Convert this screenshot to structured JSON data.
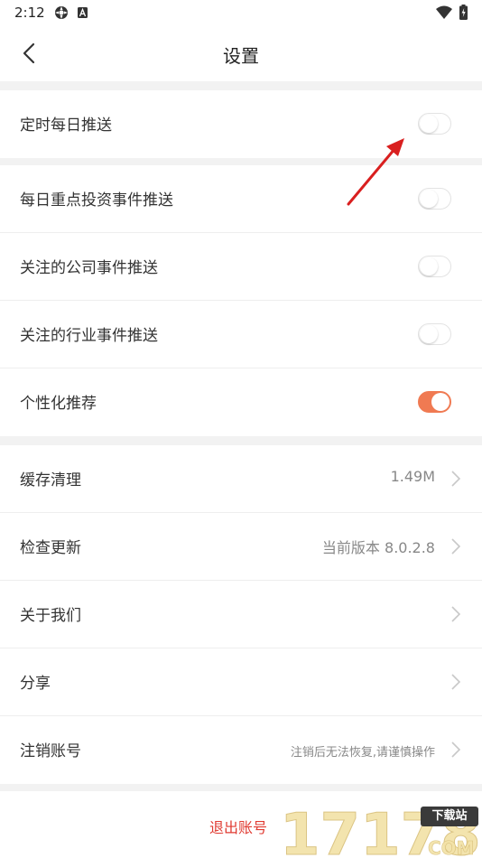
{
  "status_bar": {
    "time": "2:12",
    "icons": [
      "settings-gear-icon",
      "app-a-icon",
      "wifi-icon",
      "battery-icon"
    ]
  },
  "header": {
    "back_icon": "chevron-left-icon",
    "title": "设置"
  },
  "push_group": {
    "items": [
      {
        "label": "定时每日推送",
        "toggle_on": false
      }
    ]
  },
  "event_group": {
    "items": [
      {
        "label": "每日重点投资事件推送",
        "toggle_on": false
      },
      {
        "label": "关注的公司事件推送",
        "toggle_on": false
      },
      {
        "label": "关注的行业事件推送",
        "toggle_on": false
      },
      {
        "label": "个性化推荐",
        "toggle_on": true
      }
    ]
  },
  "misc_group": {
    "items": [
      {
        "label": "缓存清理",
        "value": "1.49M"
      },
      {
        "label": "检查更新",
        "value": "当前版本 8.0.2.8"
      },
      {
        "label": "关于我们",
        "value": ""
      },
      {
        "label": "分享",
        "value": ""
      },
      {
        "label": "注销账号",
        "value": "注销后无法恢复,请谨慎操作"
      }
    ]
  },
  "logout": {
    "label": "退出账号"
  },
  "watermark": {
    "number": "17178",
    "badge": "下载站",
    "domain": "COM"
  },
  "colors": {
    "accent": "#f07a52",
    "logout_text": "#e03b32",
    "annotation_arrow": "#d91f1f",
    "background": "#f2f2f2"
  }
}
